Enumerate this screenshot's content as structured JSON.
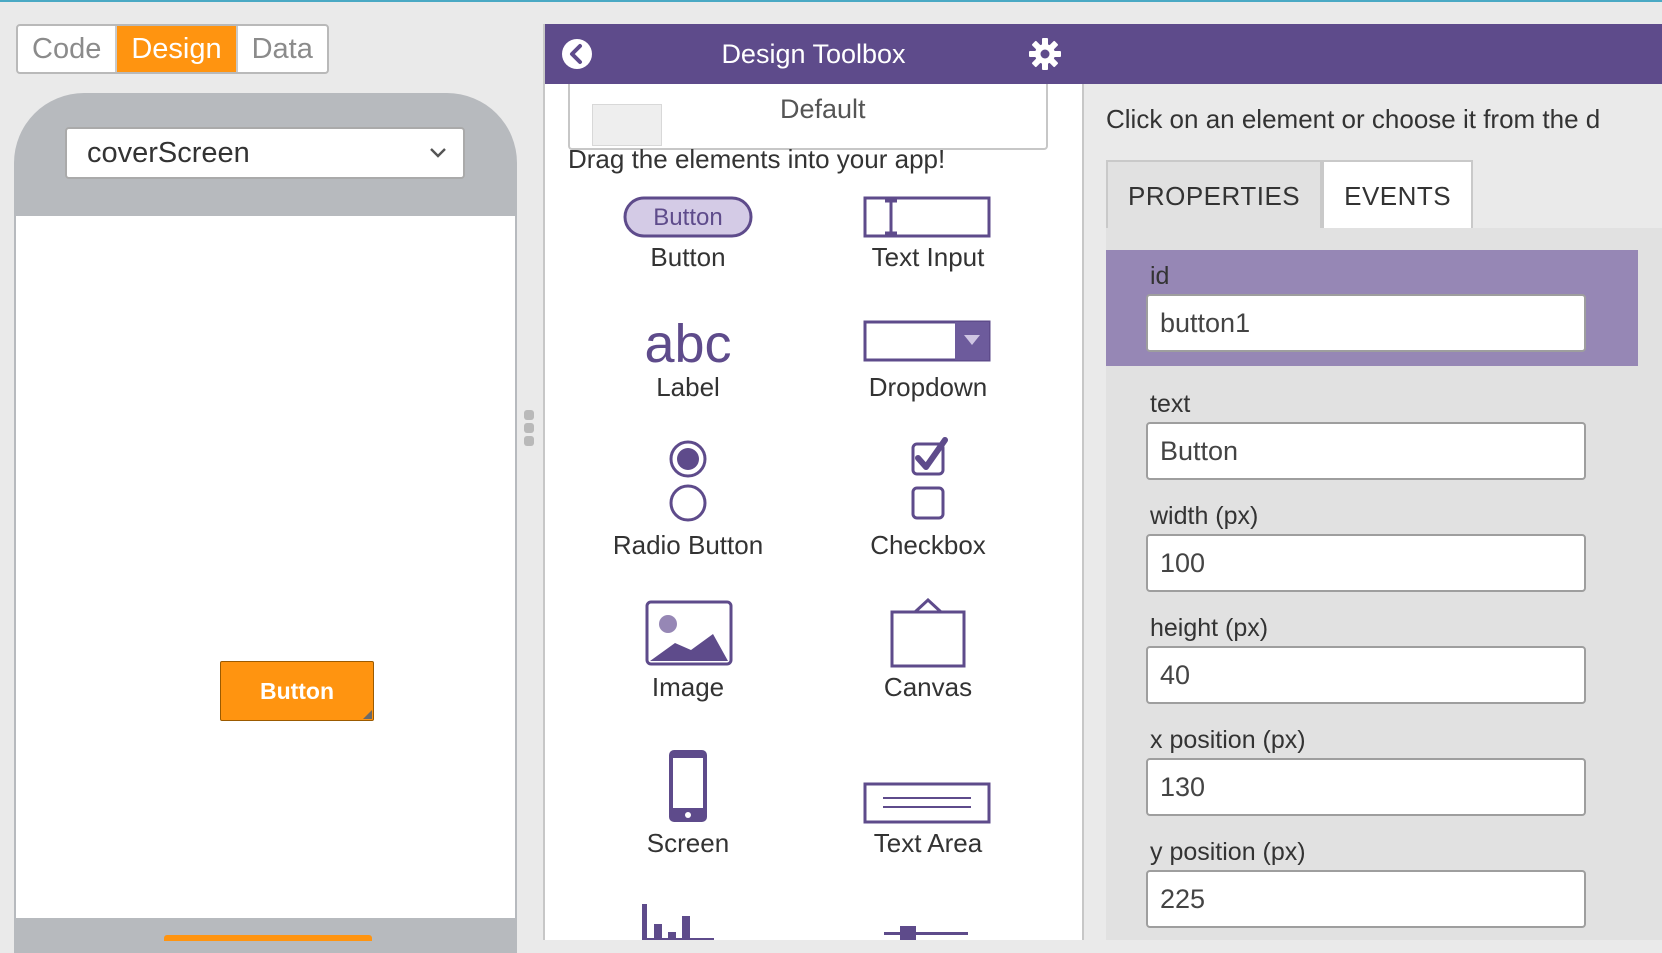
{
  "mode_toggle": {
    "code": "Code",
    "design": "Design",
    "data": "Data",
    "active": "Design"
  },
  "phone": {
    "screen_select_value": "coverScreen",
    "app_button_text": "Button"
  },
  "toolbox": {
    "title": "Design Toolbox",
    "theme_name": "Default",
    "drag_hint": "Drag the elements into your app!",
    "items": [
      {
        "label": "Button",
        "icon": "button-icon",
        "icon_text": "Button"
      },
      {
        "label": "Text Input",
        "icon": "text-input-icon"
      },
      {
        "label": "Label",
        "icon": "label-icon",
        "icon_text": "abc"
      },
      {
        "label": "Dropdown",
        "icon": "dropdown-icon"
      },
      {
        "label": "Radio Button",
        "icon": "radio-button-icon"
      },
      {
        "label": "Checkbox",
        "icon": "checkbox-icon"
      },
      {
        "label": "Image",
        "icon": "image-icon"
      },
      {
        "label": "Canvas",
        "icon": "canvas-icon"
      },
      {
        "label": "Screen",
        "icon": "screen-icon"
      },
      {
        "label": "Text Area",
        "icon": "text-area-icon"
      }
    ]
  },
  "properties": {
    "hint": "Click on an element or choose it from the d",
    "tabs": [
      "PROPERTIES",
      "EVENTS"
    ],
    "active_tab": "PROPERTIES",
    "fields": [
      {
        "label": "id",
        "value": "button1",
        "selected": true
      },
      {
        "label": "text",
        "value": "Button"
      },
      {
        "label": "width (px)",
        "value": "100"
      },
      {
        "label": "height (px)",
        "value": "40"
      },
      {
        "label": "x position (px)",
        "value": "130"
      },
      {
        "label": "y position (px)",
        "value": "225"
      }
    ]
  },
  "colors": {
    "accent_orange": "#ff9410",
    "header_purple": "#5e4b8b",
    "icon_purple": "#5e4b8b",
    "selected_row": "#9687b5"
  }
}
